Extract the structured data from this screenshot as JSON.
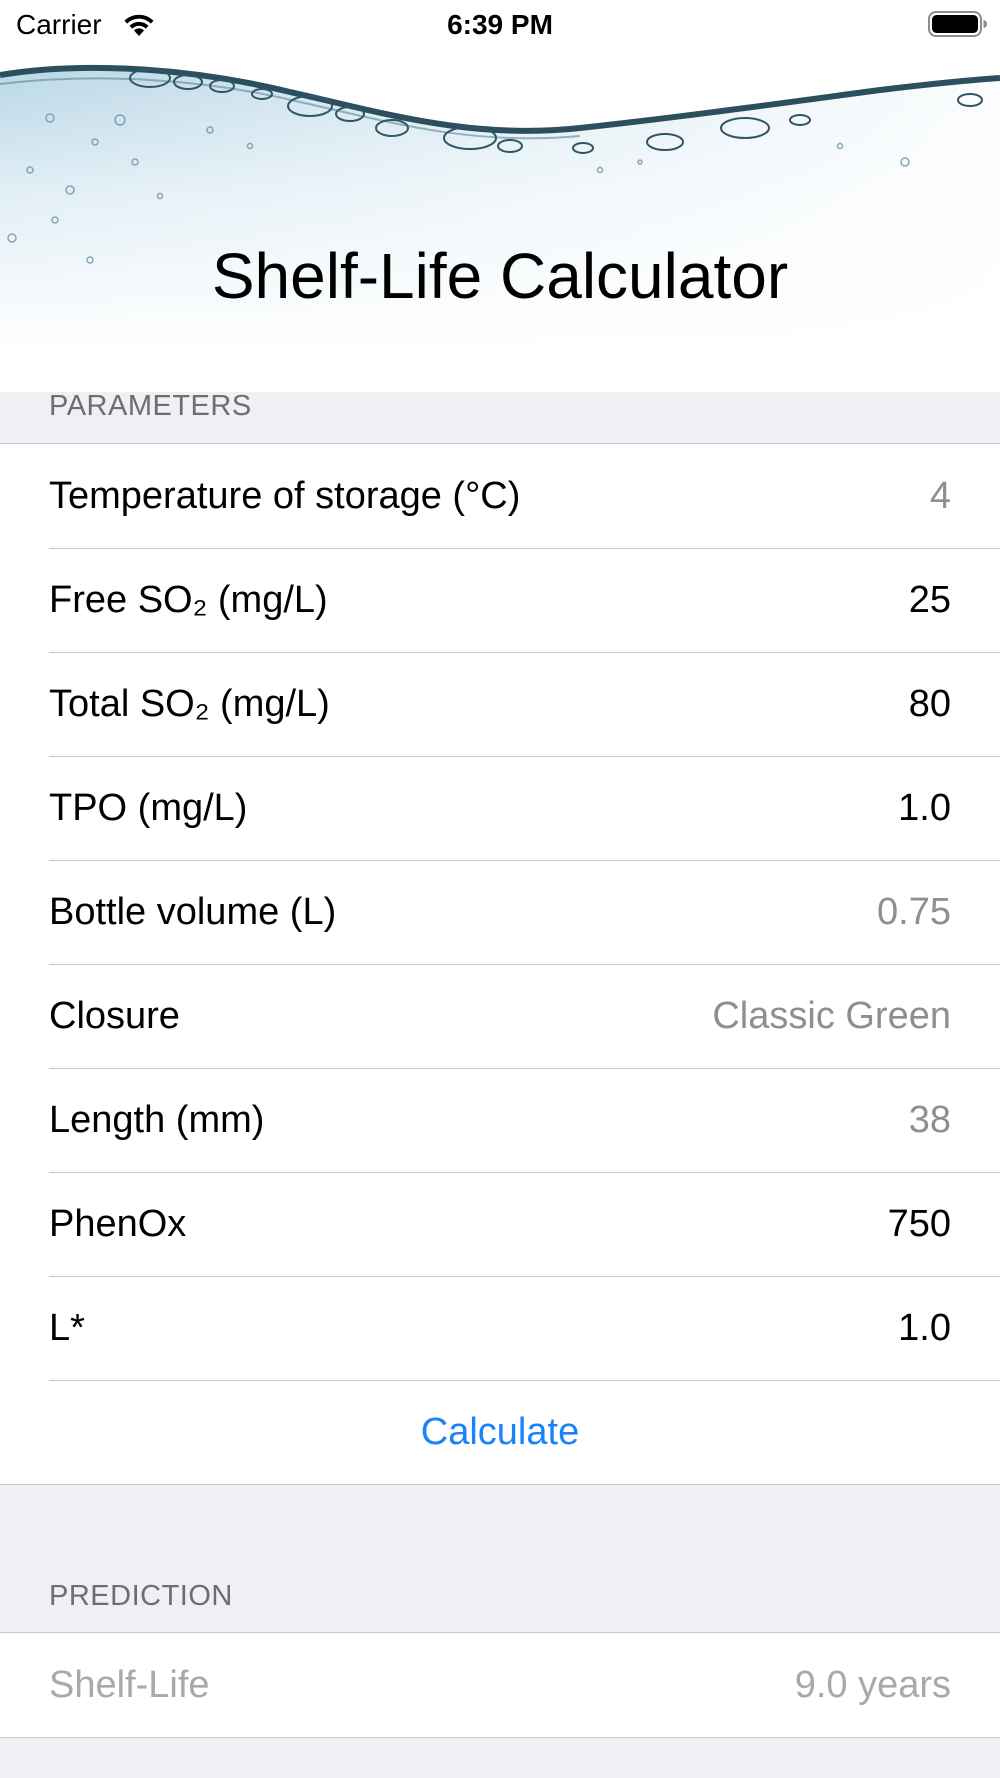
{
  "status_bar": {
    "carrier": "Carrier",
    "time": "6:39 PM",
    "wifi_icon": "wifi-icon",
    "battery_icon": "battery-full-icon"
  },
  "header": {
    "title": "Shelf-Life Calculator",
    "background": "water-surface-bubbles"
  },
  "parameters": {
    "section_title": "PARAMETERS",
    "rows": [
      {
        "label": "Temperature of storage (°C)",
        "value": "4",
        "state": "placeholder"
      },
      {
        "label": "Free SO₂ (mg/L)",
        "value": "25",
        "state": "entered"
      },
      {
        "label": "Total SO₂ (mg/L)",
        "value": "80",
        "state": "entered"
      },
      {
        "label": "TPO (mg/L)",
        "value": "1.0",
        "state": "entered"
      },
      {
        "label": "Bottle volume (L)",
        "value": "0.75",
        "state": "placeholder"
      },
      {
        "label": "Closure",
        "value": "Classic Green",
        "state": "placeholder"
      },
      {
        "label": "Length (mm)",
        "value": "38",
        "state": "placeholder"
      },
      {
        "label": "PhenOx",
        "value": "750",
        "state": "entered"
      },
      {
        "label": "L*",
        "value": "1.0",
        "state": "entered"
      }
    ],
    "calculate_label": "Calculate"
  },
  "prediction": {
    "section_title": "PREDICTION",
    "label": "Shelf-Life",
    "value": "9.0 years"
  },
  "colors": {
    "accent": "#1a82fb",
    "grouped_background": "#efeff4",
    "separator": "#c8c7cc",
    "secondary_text": "#8e8e93",
    "section_header_text": "#6d6d72"
  }
}
